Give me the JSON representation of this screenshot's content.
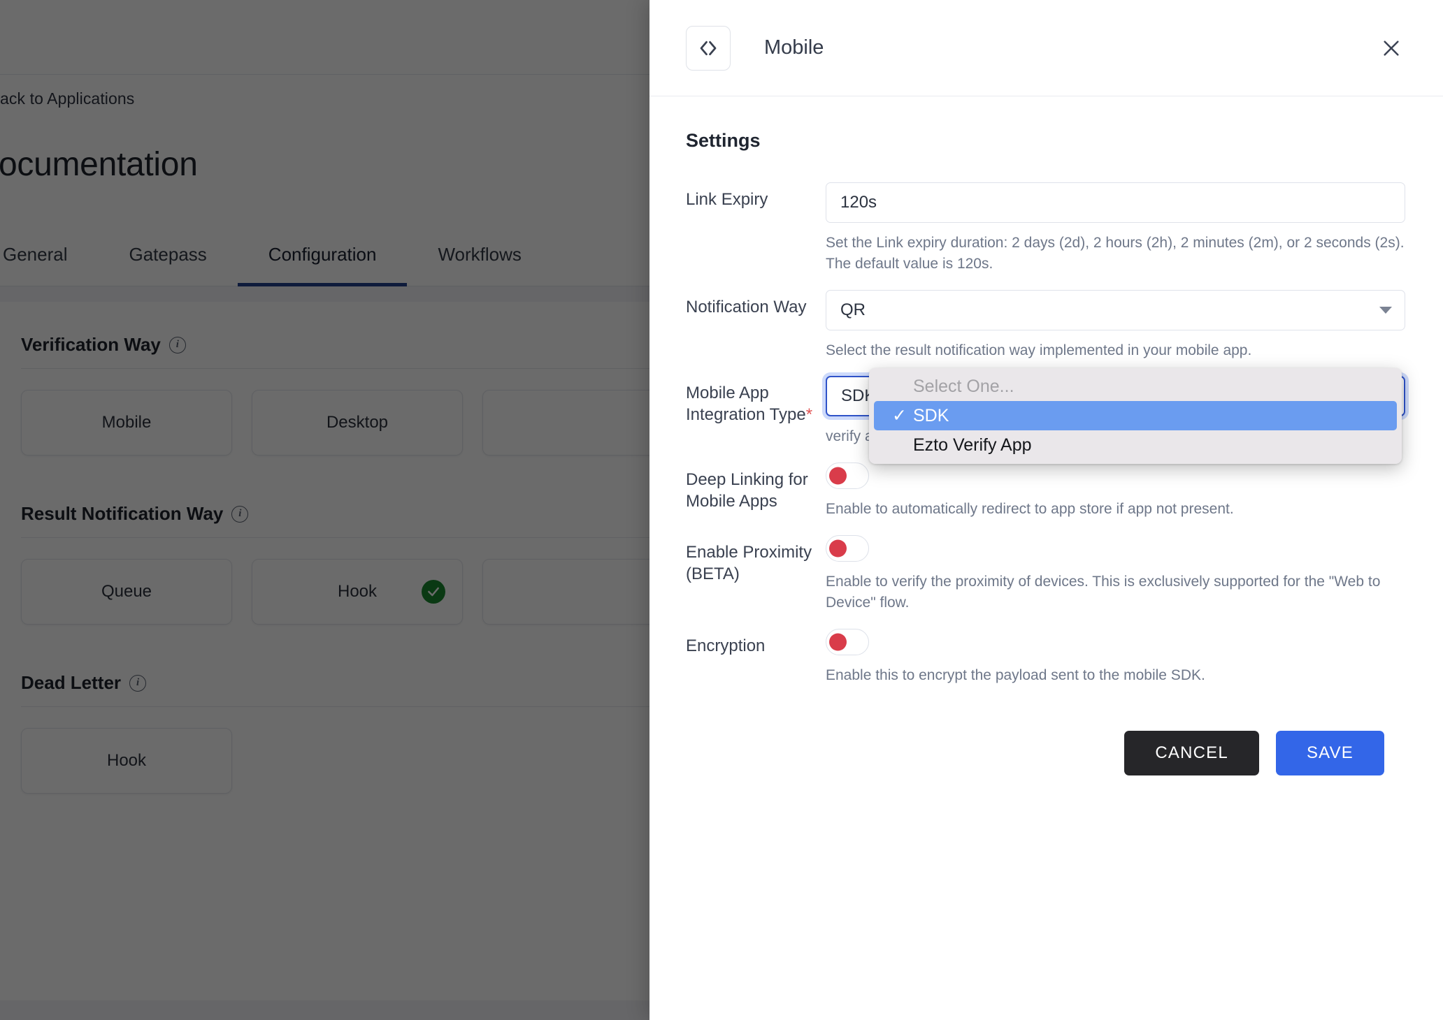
{
  "background": {
    "breadcrumb": "ack to Applications",
    "page_title": "ocumentation",
    "tabs": [
      {
        "label": "General",
        "active": false
      },
      {
        "label": "Gatepass",
        "active": false
      },
      {
        "label": "Configuration",
        "active": true
      },
      {
        "label": "Workflows",
        "active": false
      }
    ],
    "sections": [
      {
        "title": "Verification Way",
        "info_icon": "info-icon",
        "options": [
          {
            "label": "Mobile",
            "selected": false
          },
          {
            "label": "Desktop",
            "selected": false
          },
          {
            "label": "",
            "selected": false
          }
        ]
      },
      {
        "title": "Result Notification Way",
        "info_icon": "info-icon",
        "options": [
          {
            "label": "Queue",
            "selected": false
          },
          {
            "label": "Hook",
            "selected": true
          },
          {
            "label": "",
            "selected": false
          }
        ]
      },
      {
        "title": "Dead Letter",
        "info_icon": "info-icon",
        "options": [
          {
            "label": "Hook",
            "selected": false
          }
        ]
      }
    ]
  },
  "panel": {
    "badge_icon": "code-icon",
    "title": "Mobile",
    "close_icon": "close-icon",
    "settings_heading": "Settings",
    "fields": {
      "link_expiry": {
        "label": "Link Expiry",
        "value": "120s",
        "placeholder": "120s",
        "help": "Set the Link expiry duration: 2 days (2d), 2 hours (2h), 2 minutes (2m), or 2 seconds (2s). The default value is 120s."
      },
      "notification_way": {
        "label": "Notification Way",
        "value": "QR",
        "caret_icon": "chevron-down-icon",
        "help": "Select the result notification way implemented in your mobile app."
      },
      "integration_type": {
        "label": "Mobile App Integration Type",
        "required_marker": "*",
        "value": "SDK",
        "help_tail": "verify app → Use our official app from stores."
      },
      "deep_linking": {
        "label": "Deep Linking for Mobile Apps",
        "state": "off",
        "help": "Enable to automatically redirect to app store if app not present."
      },
      "proximity": {
        "label": "Enable Proximity (BETA)",
        "state": "off",
        "help": "Enable to verify the proximity of devices. This is exclusively supported for the \"Web to Device\" flow."
      },
      "encryption": {
        "label": "Encryption",
        "state": "off",
        "help": "Enable this to encrypt the payload sent to the mobile SDK."
      }
    },
    "actions": {
      "cancel_label": "CANCEL",
      "save_label": "SAVE"
    }
  },
  "dropdown": {
    "items": [
      {
        "label": "Select One...",
        "kind": "placeholder",
        "checked": false
      },
      {
        "label": "SDK",
        "kind": "option",
        "checked": true
      },
      {
        "label": "Ezto Verify App",
        "kind": "option",
        "checked": false
      }
    ],
    "check_glyph": "✓"
  },
  "colors": {
    "accent_blue": "#3366e8",
    "tab_underline": "#23408e",
    "toggle_off_knob": "#d93c4a",
    "success_green": "#19892f",
    "dropdown_highlight": "#6a9cf0",
    "required_red": "#e05252"
  }
}
